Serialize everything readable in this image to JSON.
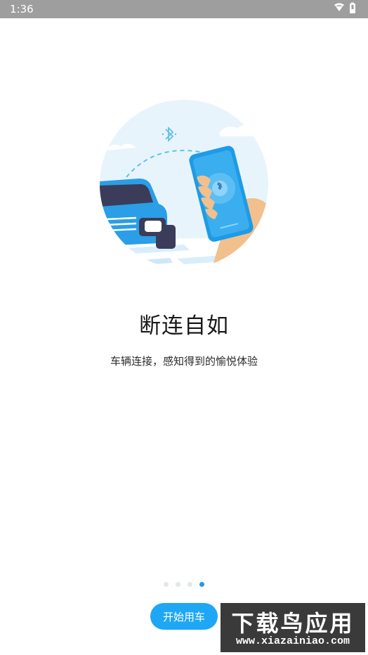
{
  "status_bar": {
    "time": "1:36",
    "icons": [
      "wifi-icon",
      "battery-icon"
    ]
  },
  "onboarding": {
    "headline": "断连自如",
    "subtitle": "车辆连接，感知得到的愉悦体验",
    "page_indicator": {
      "total": 4,
      "active": 4
    },
    "start_button_label": "开始用车"
  },
  "watermark": {
    "title": "下载鸟应用",
    "url": "www.xiazainiao.com"
  },
  "colors": {
    "accent": "#1ea7f4",
    "status_bar": "#9e9e9e",
    "illustration_bg": "#e8f4fc"
  }
}
